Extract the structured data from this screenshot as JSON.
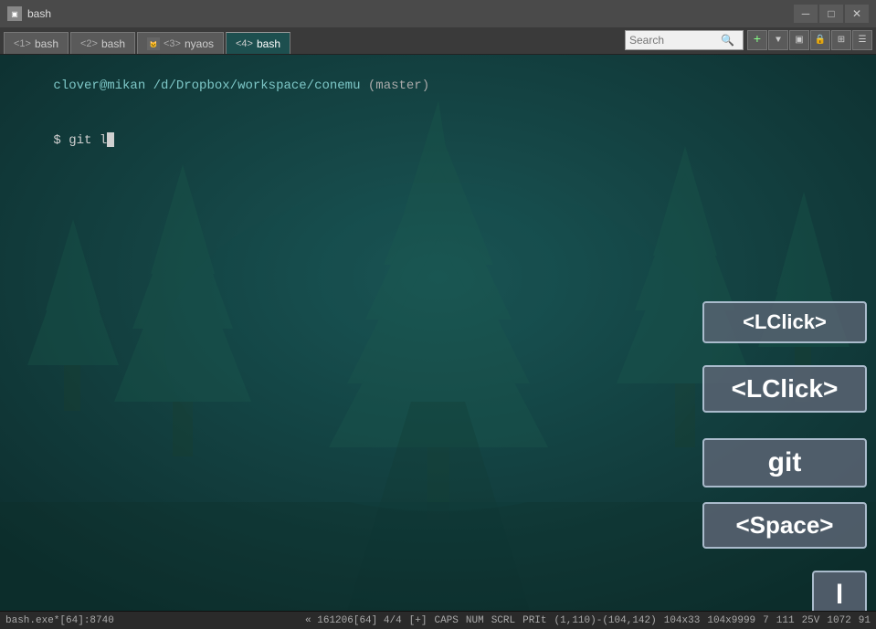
{
  "titlebar": {
    "icon": "▣",
    "title": "bash",
    "minimize_label": "─",
    "maximize_label": "□",
    "close_label": "✕"
  },
  "tabs": [
    {
      "id": 1,
      "number": "1>",
      "label": "bash",
      "icon": "bash",
      "active": false
    },
    {
      "id": 2,
      "number": "2>",
      "label": "bash",
      "icon": "bash",
      "active": false
    },
    {
      "id": 3,
      "number": "3>",
      "label": "nyaos",
      "icon": "nyaos",
      "active": false
    },
    {
      "id": 4,
      "number": "4>",
      "label": "bash",
      "icon": "bash",
      "active": true
    }
  ],
  "search": {
    "placeholder": "Search",
    "value": ""
  },
  "terminal": {
    "prompt_user": "clover@mikan",
    "prompt_path": " /d/Dropbox/workspace/conemu",
    "prompt_branch": " (master)",
    "prompt_dollar": "$",
    "command": " git l"
  },
  "key_overlays": [
    {
      "id": 1,
      "label": "<LClick>",
      "pos": "top270"
    },
    {
      "id": 2,
      "label": "<LClick>",
      "pos": "top340"
    },
    {
      "id": 3,
      "label": "git",
      "pos": "top420"
    },
    {
      "id": 4,
      "label": "<Space>",
      "pos": "top490"
    },
    {
      "id": 5,
      "label": "l",
      "pos": "top565"
    }
  ],
  "statusbar": {
    "left": "bash.exe*[64]:8740",
    "encoding": "« 161206[64] 4/4",
    "insert": "[+]",
    "caps": "CAPS",
    "num": "NUM",
    "scrl": "SCRL",
    "pri": "PRIt",
    "position": "(1,110)-(104,142)",
    "size": "104x33",
    "maxsize": "104x9999",
    "col1": "7",
    "col2": "111",
    "col3": "25V",
    "col4": "1072",
    "col5": "91"
  }
}
